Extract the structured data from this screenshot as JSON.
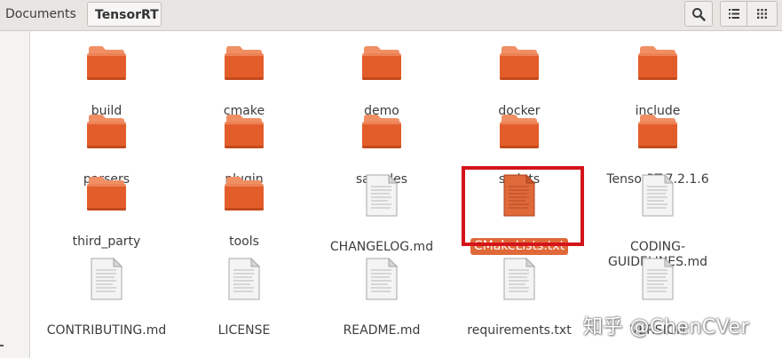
{
  "breadcrumbs": [
    "Documents",
    "TensorRT"
  ],
  "toolbar": {
    "search_icon": "search-icon",
    "list_icon": "list-view-icon",
    "grid_icon": "grid-view-icon"
  },
  "colors": {
    "folder": "#e35d2a",
    "folder_tab": "#f08f63",
    "selection": "#e0693a",
    "highlight_box": "#d4141b",
    "toolbar_bg": "#e8e6e3"
  },
  "files": [
    {
      "label": "build",
      "kind": "folder"
    },
    {
      "label": "cmake",
      "kind": "folder"
    },
    {
      "label": "demo",
      "kind": "folder"
    },
    {
      "label": "docker",
      "kind": "folder"
    },
    {
      "label": "include",
      "kind": "folder"
    },
    {
      "label": "parsers",
      "kind": "folder"
    },
    {
      "label": "plugin",
      "kind": "folder"
    },
    {
      "label": "samples",
      "kind": "folder"
    },
    {
      "label": "scripts",
      "kind": "folder"
    },
    {
      "label": "TensorRT-7.2.1.6",
      "kind": "folder"
    },
    {
      "label": "third_party",
      "kind": "folder"
    },
    {
      "label": "tools",
      "kind": "folder"
    },
    {
      "label": "CHANGELOG.md",
      "kind": "document"
    },
    {
      "label": "CMakeLists.txt",
      "kind": "document",
      "selected": true
    },
    {
      "label": "CODING-\nGUIDELINES.md",
      "kind": "document"
    },
    {
      "label": "CONTRIBUTING.md",
      "kind": "document"
    },
    {
      "label": "LICENSE",
      "kind": "document"
    },
    {
      "label": "README.md",
      "kind": "document"
    },
    {
      "label": "requirements.txt",
      "kind": "document"
    },
    {
      "label": "VERSION",
      "kind": "document"
    }
  ],
  "watermark": "知乎 @ChenCVer"
}
